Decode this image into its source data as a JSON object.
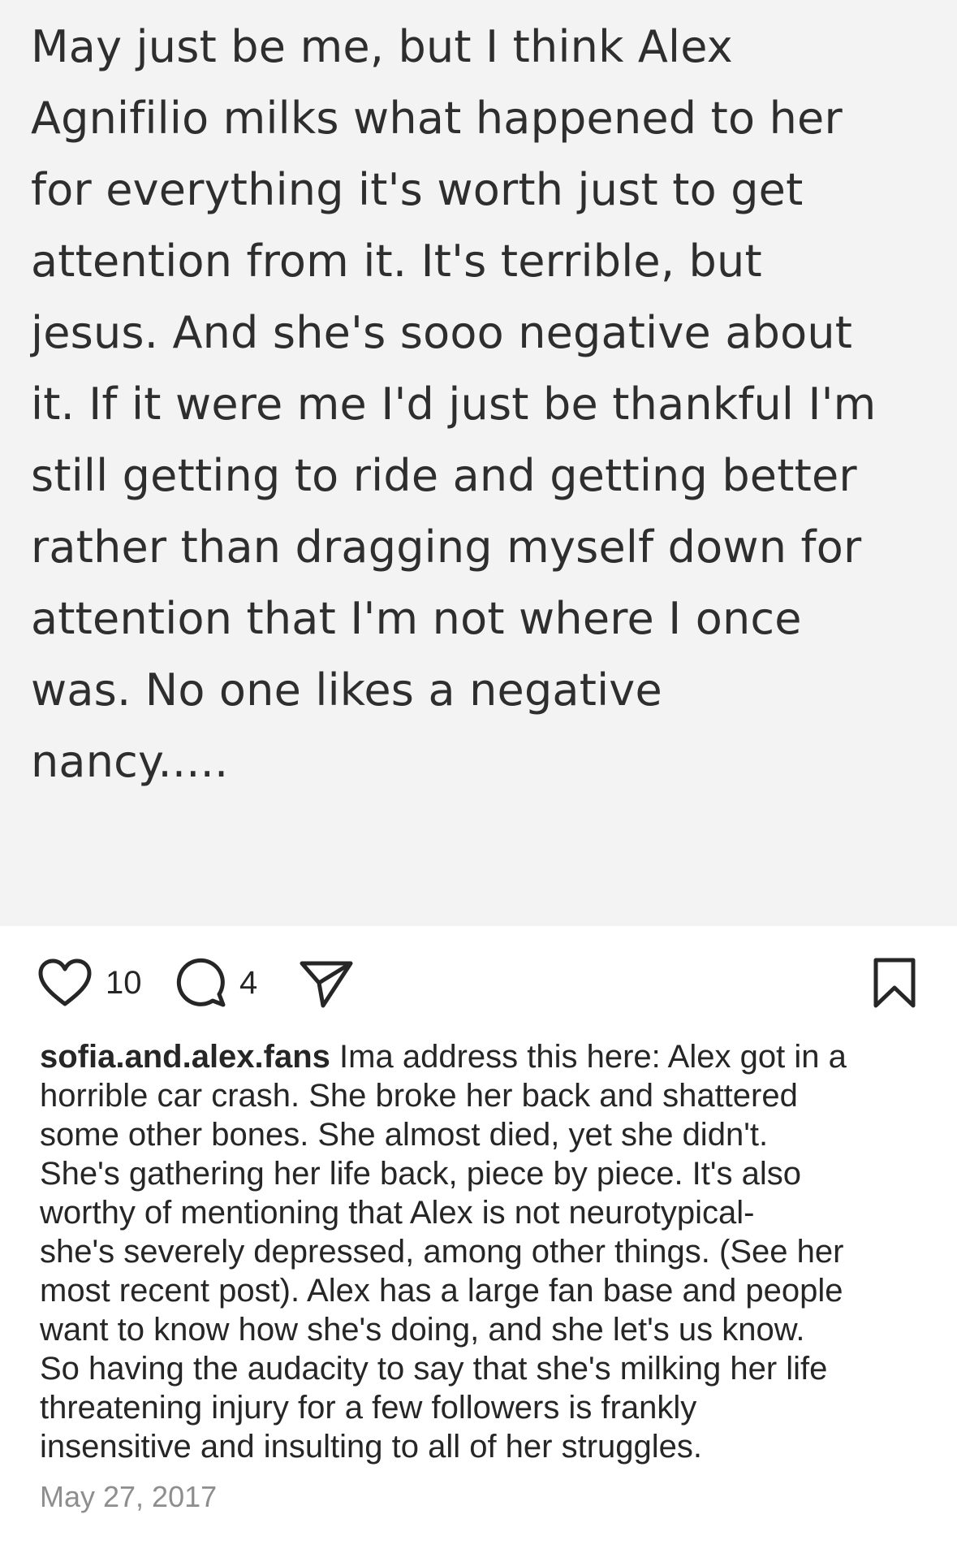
{
  "post": {
    "text_lines": [
      "May just be me, but I think Alex",
      "Agnifilio milks what happened to her",
      "for everything it's worth just to get",
      "attention from it. It's terrible, but",
      "jesus. And she's sooo negative about",
      "it. If it were me I'd just be thankful I'm",
      "still getting to ride and getting better",
      "rather than dragging myself down for",
      "attention that I'm not where I once",
      "was. No one likes a negative",
      "nancy....."
    ]
  },
  "actions": {
    "like_count": "10",
    "comment_count": "4"
  },
  "caption": {
    "username": "sofia.and.alex.fans",
    "first_line_text": " Ima address this here: Alex got in a",
    "lines": [
      "horrible car crash. She broke her back and shattered",
      "some other bones. She almost died, yet she didn't.",
      "She's gathering her life back, piece by piece. It's also",
      "worthy of mentioning that Alex is not neurotypical-",
      "she's severely depressed, among other things. (See her",
      "most recent post). Alex has a large fan base and people",
      "want to know how she's doing, and she let's us know.",
      "So having the audacity to say that she's milking her life",
      "threatening injury for a few followers is frankly",
      "insensitive and insulting to all of her struggles."
    ]
  },
  "timestamp": "May 27, 2017",
  "icons": {
    "like": "heart-icon",
    "comment": "comment-bubble-icon",
    "share": "paper-plane-icon",
    "save": "bookmark-icon"
  }
}
